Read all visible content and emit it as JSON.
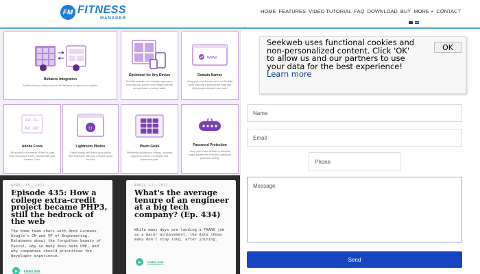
{
  "header": {
    "logo_badge": "FM",
    "logo_title": "FITNESS",
    "logo_subtitle": "MANAGER",
    "nav": [
      "HOME",
      "FEATURES",
      "VIDEO TUTORIAL",
      "FAQ",
      "DOWNLOAD",
      "BUY",
      "MORE",
      "+",
      "CONTACT"
    ],
    "flags": [
      "uk-flag",
      "thai-flag"
    ],
    "accent_color": "#1c7ed6"
  },
  "features": [
    {
      "title": "Behance Integration",
      "desc": "Portfolio lets you easily connect with Behance to import your projects."
    },
    {
      "title": "Optimized for Any Device",
      "desc": "Portfolio websites are instantly responsive, ensuring your content and images look fab on any device or screen width."
    },
    {
      "title": "Domain Names",
      "desc": "Using your own domain name on Portfolio gives your site a professional edge and helps people discover your work.",
      "url_label": "www."
    },
    {
      "title": "Adobe Fonts",
      "desc": "Get access to thousands of best-in-class fonts with Adobe Fonts, included with your Creative Cloud."
    },
    {
      "title": "Lightroom Photos",
      "desc": "Easily access and import your photos from Lightroom with your Creative Cloud account."
    },
    {
      "title": "Photo Grids",
      "desc": "Effortlessly display your images, including Lightroom photos, in beautiful and expressive grids."
    },
    {
      "title": "Password Protection",
      "desc": "Keep your entire website or selected pages private with Portfolio's password protection setting."
    }
  ],
  "posts": [
    {
      "date": "APRIL 15, 2022",
      "title": "Episode 435: How a college extra-credit project became PHP3, still the bedrock of the web",
      "excerpt": "The home team chats with Andi Gutmans, Google's GM and VP of Engineering, Databases about the forgotten beauty of Pascal, why so many devs hate PHP, and why companies should prioritize the developer experience.",
      "listen": "Listen now"
    },
    {
      "date": "APRIL 12, 2022",
      "title": "What's the average tenure of an engineer at a big tech company? (Ep. 434)",
      "excerpt": "While many devs are landing a FAANG job as a major achievement, the data shows many don't stay long, after joining.",
      "listen": "Listen now"
    }
  ],
  "cookie": {
    "text": "Seekweb uses functional cookies and non-personalized content. Click 'OK' to allow us and our partners to use your data for the best experience!",
    "more": "Learn more",
    "ok": "OK"
  },
  "form": {
    "name": "Name",
    "email": "Email",
    "phone": "Phone",
    "message": "Message",
    "send": "Send"
  }
}
